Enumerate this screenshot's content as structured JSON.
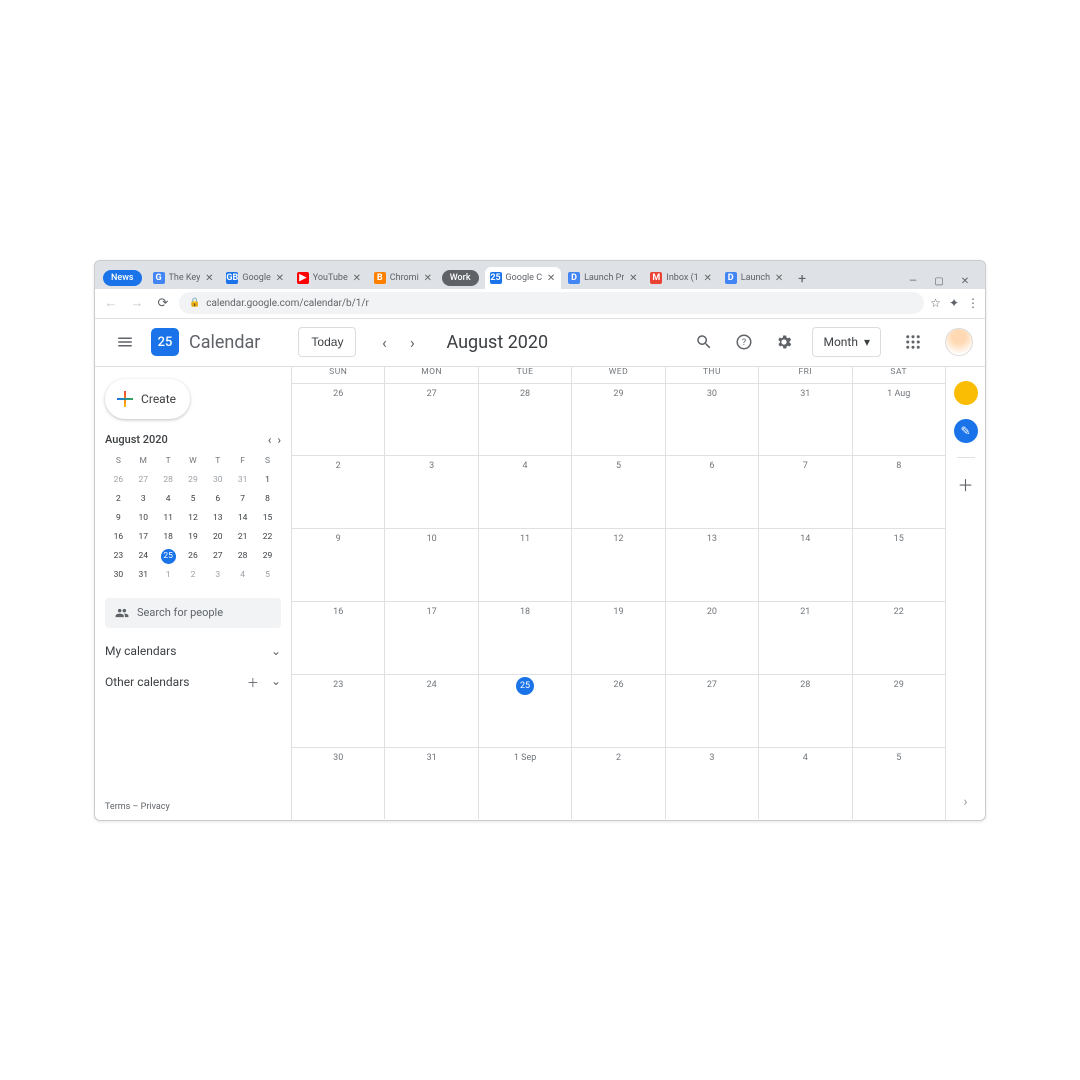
{
  "browser": {
    "tabs": [
      {
        "label": "News",
        "is_pill": true
      },
      {
        "label": "The Key",
        "favicon": "G"
      },
      {
        "label": "Google",
        "favicon": "GB"
      },
      {
        "label": "YouTube",
        "favicon": "▶"
      },
      {
        "label": "Chromi",
        "favicon": "B"
      },
      {
        "label": "Work",
        "is_group": true
      },
      {
        "label": "Google C",
        "favicon": "25",
        "active": true
      },
      {
        "label": "Launch Pr",
        "favicon": "D"
      },
      {
        "label": "Inbox (1",
        "favicon": "M"
      },
      {
        "label": "Launch",
        "favicon": "D"
      }
    ],
    "url": "calendar.google.com/calendar/b/1/r"
  },
  "header": {
    "logo_day": "25",
    "app_name": "Calendar",
    "today_label": "Today",
    "month_title": "August 2020",
    "view_label": "Month"
  },
  "sidebar": {
    "create_label": "Create",
    "mini_month": "August 2020",
    "dow": [
      "S",
      "M",
      "T",
      "W",
      "T",
      "F",
      "S"
    ],
    "rows": [
      [
        {
          "n": "26",
          "m": 1
        },
        {
          "n": "27",
          "m": 1
        },
        {
          "n": "28",
          "m": 1
        },
        {
          "n": "29",
          "m": 1
        },
        {
          "n": "30",
          "m": 1
        },
        {
          "n": "31",
          "m": 1
        },
        {
          "n": "1"
        }
      ],
      [
        {
          "n": "2"
        },
        {
          "n": "3"
        },
        {
          "n": "4"
        },
        {
          "n": "5"
        },
        {
          "n": "6"
        },
        {
          "n": "7"
        },
        {
          "n": "8"
        }
      ],
      [
        {
          "n": "9"
        },
        {
          "n": "10"
        },
        {
          "n": "11"
        },
        {
          "n": "12"
        },
        {
          "n": "13"
        },
        {
          "n": "14"
        },
        {
          "n": "15"
        }
      ],
      [
        {
          "n": "16"
        },
        {
          "n": "17"
        },
        {
          "n": "18"
        },
        {
          "n": "19"
        },
        {
          "n": "20"
        },
        {
          "n": "21"
        },
        {
          "n": "22"
        }
      ],
      [
        {
          "n": "23"
        },
        {
          "n": "24"
        },
        {
          "n": "25",
          "t": 1
        },
        {
          "n": "26"
        },
        {
          "n": "27"
        },
        {
          "n": "28"
        },
        {
          "n": "29"
        }
      ],
      [
        {
          "n": "30"
        },
        {
          "n": "31"
        },
        {
          "n": "1",
          "m": 1
        },
        {
          "n": "2",
          "m": 1
        },
        {
          "n": "3",
          "m": 1
        },
        {
          "n": "4",
          "m": 1
        },
        {
          "n": "5",
          "m": 1
        }
      ]
    ],
    "search_placeholder": "Search for people",
    "my_cal_label": "My calendars",
    "other_cal_label": "Other calendars",
    "terms": "Terms",
    "privacy": "Privacy"
  },
  "grid": {
    "dow": [
      "SUN",
      "MON",
      "TUE",
      "WED",
      "THU",
      "FRI",
      "SAT"
    ],
    "weeks": [
      [
        {
          "n": "26"
        },
        {
          "n": "27"
        },
        {
          "n": "28"
        },
        {
          "n": "29"
        },
        {
          "n": "30"
        },
        {
          "n": "31"
        },
        {
          "n": "1 Aug",
          "label": 1
        }
      ],
      [
        {
          "n": "2"
        },
        {
          "n": "3"
        },
        {
          "n": "4"
        },
        {
          "n": "5"
        },
        {
          "n": "6"
        },
        {
          "n": "7"
        },
        {
          "n": "8"
        }
      ],
      [
        {
          "n": "9"
        },
        {
          "n": "10"
        },
        {
          "n": "11"
        },
        {
          "n": "12"
        },
        {
          "n": "13"
        },
        {
          "n": "14"
        },
        {
          "n": "15"
        }
      ],
      [
        {
          "n": "16"
        },
        {
          "n": "17"
        },
        {
          "n": "18"
        },
        {
          "n": "19"
        },
        {
          "n": "20"
        },
        {
          "n": "21"
        },
        {
          "n": "22"
        }
      ],
      [
        {
          "n": "23"
        },
        {
          "n": "24"
        },
        {
          "n": "25",
          "t": 1
        },
        {
          "n": "26"
        },
        {
          "n": "27"
        },
        {
          "n": "28"
        },
        {
          "n": "29"
        }
      ],
      [
        {
          "n": "30"
        },
        {
          "n": "31"
        },
        {
          "n": "1 Sep",
          "label": 1
        },
        {
          "n": "2"
        },
        {
          "n": "3"
        },
        {
          "n": "4"
        },
        {
          "n": "5"
        }
      ]
    ]
  }
}
